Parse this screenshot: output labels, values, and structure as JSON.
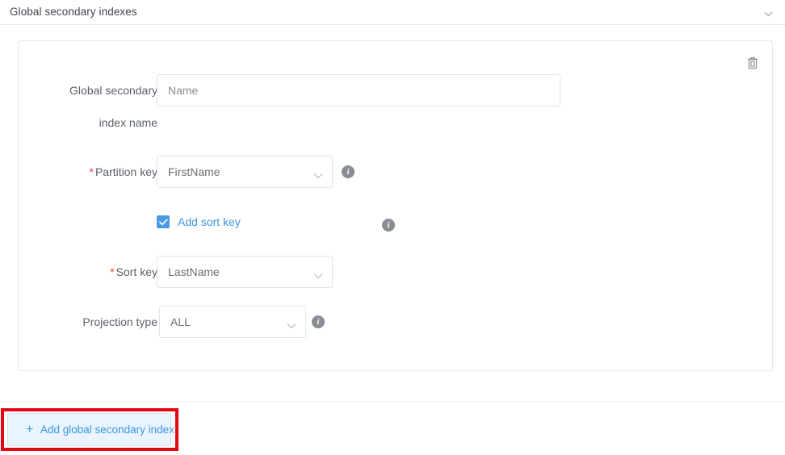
{
  "section": {
    "title": "Global secondary indexes",
    "collapse_icon": "chevron-down-icon"
  },
  "index_card": {
    "delete_icon": "trash-icon",
    "fields": {
      "index_name": {
        "label_line1": "Global secondary",
        "label_line2": "index name",
        "value": "",
        "placeholder": "Name",
        "required": false
      },
      "partition_key": {
        "label": "Partition key",
        "required_marker": "*",
        "value": "FirstName",
        "required": true,
        "info_icon": "info-icon"
      },
      "add_sort_key": {
        "label": "Add sort key",
        "checked": true,
        "checkbox_icon": "checkmark-icon",
        "info_icon": "info-icon"
      },
      "sort_key": {
        "label": "Sort key",
        "required_marker": "*",
        "value": "LastName",
        "required": true
      },
      "projection_type": {
        "label": "Projection type",
        "value": "ALL",
        "required": false,
        "info_icon": "info-icon"
      }
    }
  },
  "footer": {
    "add_button": {
      "plus": "+",
      "label": "Add global secondary index"
    },
    "annotation": {
      "color": "#e30713"
    }
  },
  "colors": {
    "link_blue": "#3d96e5",
    "checkbox_blue": "#4a9ae8",
    "required_red": "#e8443a",
    "annotation_red": "#e30713",
    "button_bg": "#eaf4fd",
    "border_gray": "#e3e4e8",
    "label_gray": "#5a5f69"
  }
}
